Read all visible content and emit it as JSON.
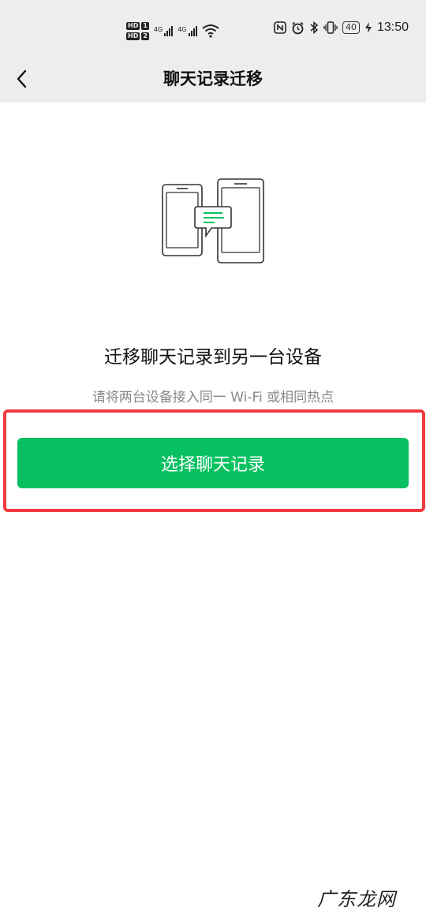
{
  "status_bar": {
    "hd1": "HD",
    "hd1_num": "1",
    "hd2": "HD",
    "hd2_num": "2",
    "net1": "4G",
    "net2": "4G",
    "battery": "40",
    "time": "13:50",
    "icons": [
      "nfc-icon",
      "alarm-icon",
      "bluetooth-icon",
      "vibrate-icon",
      "wifi-icon",
      "charging-icon"
    ]
  },
  "header": {
    "title": "聊天记录迁移"
  },
  "main": {
    "heading": "迁移聊天记录到另一台设备",
    "subtitle": "请将两台设备接入同一 Wi-Fi 或相同热点",
    "select_button": "选择聊天记录"
  },
  "watermark": "广东龙网",
  "colors": {
    "accent": "#07c160",
    "highlight": "#f03a3e",
    "header_bg": "#ededed"
  }
}
